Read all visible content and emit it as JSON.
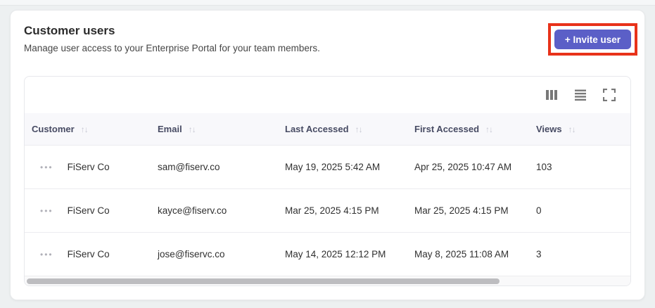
{
  "header": {
    "title": "Customer users",
    "subtitle": "Manage user access to your Enterprise Portal for your team members.",
    "invite_button_label": "+ Invite user"
  },
  "colors": {
    "invite_button": "#5b5fc7",
    "highlight_annotation": "#e8321a",
    "table_header_bg": "#f8f8fb",
    "page_bg": "#edf0f1"
  },
  "toolbar": {
    "icons": [
      "columns-icon",
      "row-density-icon",
      "fullscreen-icon"
    ]
  },
  "table": {
    "sort_glyph": "↑↓",
    "row_menu_glyph": "•••",
    "columns": [
      {
        "label": "Customer"
      },
      {
        "label": "Email"
      },
      {
        "label": "Last Accessed"
      },
      {
        "label": "First Accessed"
      },
      {
        "label": "Views"
      }
    ],
    "rows": [
      {
        "customer": "FiServ Co",
        "email": "sam@fiserv.co",
        "last_accessed": "May 19, 2025 5:42 AM",
        "first_accessed": "Apr 25, 2025 10:47 AM",
        "views": "103"
      },
      {
        "customer": "FiServ Co",
        "email": "kayce@fiserv.co",
        "last_accessed": "Mar 25, 2025 4:15 PM",
        "first_accessed": "Mar 25, 2025 4:15 PM",
        "views": "0"
      },
      {
        "customer": "FiServ Co",
        "email": "jose@fiservc.co",
        "last_accessed": "May 14, 2025 12:12 PM",
        "first_accessed": "May 8, 2025 11:08 AM",
        "views": "3"
      }
    ]
  }
}
